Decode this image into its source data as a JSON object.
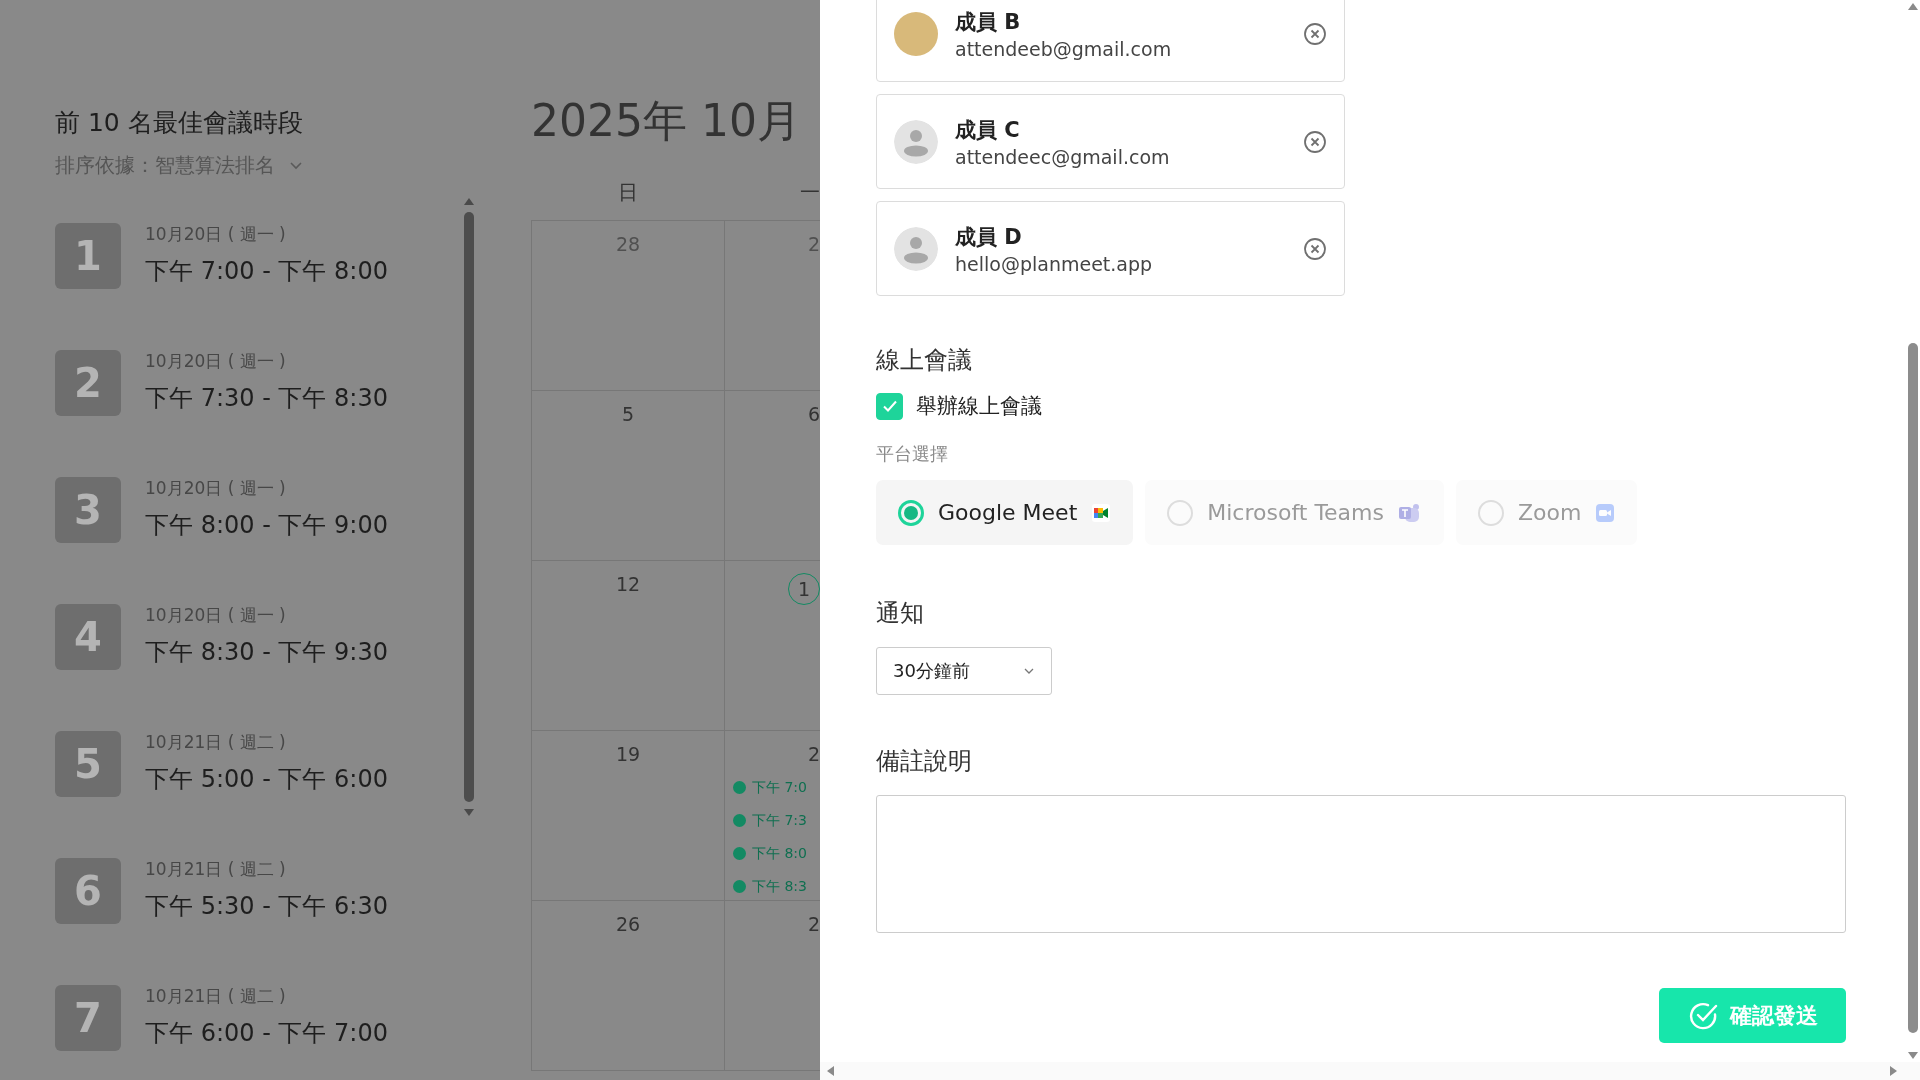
{
  "ranking": {
    "title": "前 10 名最佳會議時段",
    "sort_label": "排序依據：",
    "sort_value": "智慧算法排名",
    "slots": [
      {
        "rank": "1",
        "date": "10月20日 ( 週一 )",
        "time": "下午 7:00 - 下午 8:00"
      },
      {
        "rank": "2",
        "date": "10月20日 ( 週一 )",
        "time": "下午 7:30 - 下午 8:30"
      },
      {
        "rank": "3",
        "date": "10月20日 ( 週一 )",
        "time": "下午 8:00 - 下午 9:00"
      },
      {
        "rank": "4",
        "date": "10月20日 ( 週一 )",
        "time": "下午 8:30 - 下午 9:30"
      },
      {
        "rank": "5",
        "date": "10月21日 ( 週二 )",
        "time": "下午 5:00 - 下午 6:00"
      },
      {
        "rank": "6",
        "date": "10月21日 ( 週二 )",
        "time": "下午 5:30 - 下午 6:30"
      },
      {
        "rank": "7",
        "date": "10月21日 ( 週二 )",
        "time": "下午 6:00 - 下午 7:00"
      }
    ]
  },
  "calendar": {
    "title": "2025年 10月",
    "weekdays": [
      "日",
      "一"
    ],
    "weeks": [
      {
        "cells": [
          {
            "day": "28",
            "outside": true,
            "today": false
          },
          {
            "day": "2",
            "outside": true,
            "today": false
          }
        ]
      },
      {
        "cells": [
          {
            "day": "5",
            "outside": false,
            "today": false
          },
          {
            "day": "6",
            "outside": false,
            "today": false
          }
        ]
      },
      {
        "cells": [
          {
            "day": "12",
            "outside": false,
            "today": false
          },
          {
            "day": "1",
            "outside": false,
            "today": true
          }
        ]
      },
      {
        "cells": [
          {
            "day": "19",
            "outside": false,
            "today": false
          },
          {
            "day": "2",
            "outside": false,
            "today": false,
            "events": [
              "下午 7:0",
              "下午 7:3",
              "下午 8:0",
              "下午 8:3"
            ]
          }
        ]
      },
      {
        "cells": [
          {
            "day": "26",
            "outside": false,
            "today": false
          },
          {
            "day": "2",
            "outside": false,
            "today": false
          }
        ]
      }
    ]
  },
  "attendees": [
    {
      "name": "成員 B",
      "email": "attendeeb@gmail.com",
      "kind": "photo"
    },
    {
      "name": "成員 C",
      "email": "attendeec@gmail.com",
      "kind": "default"
    },
    {
      "name": "成員 D",
      "email": "hello@planmeet.app",
      "kind": "default"
    }
  ],
  "online_meeting": {
    "heading": "線上會議",
    "checkbox": {
      "label": "舉辦線上會議",
      "checked": true
    },
    "platform_label": "平台選擇",
    "platforms": [
      {
        "name": "Google Meet",
        "kind": "meet",
        "selected": true,
        "disabled": false
      },
      {
        "name": "Microsoft Teams",
        "kind": "teams",
        "selected": false,
        "disabled": true
      },
      {
        "name": "Zoom",
        "kind": "zoom",
        "selected": false,
        "disabled": true
      }
    ]
  },
  "notification": {
    "heading": "通知",
    "value": "30分鐘前"
  },
  "notes": {
    "heading": "備註說明"
  },
  "submit": {
    "label": "確認發送"
  }
}
